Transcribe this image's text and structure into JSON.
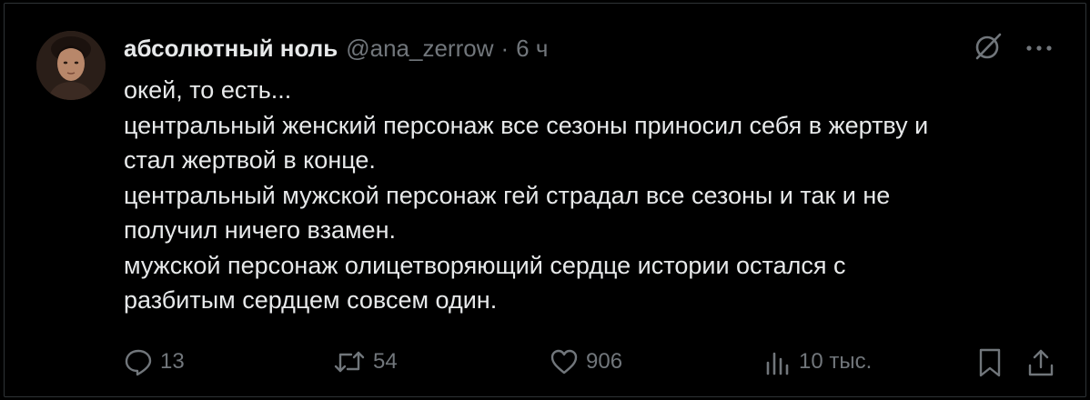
{
  "tweet": {
    "display_name": "абсолютный ноль",
    "handle": "@ana_zerrow",
    "separator": "·",
    "timestamp": "6 ч",
    "text": "окей, то есть...\nцентральный женский персонаж все сезоны приносил себя в жертву и\nстал жертвой в конце.\nцентральный мужской персонаж гей страдал все сезоны и так и не\nполучил ничего взамен.\nмужской персонаж олицетворяющий сердце истории остался с\nразбитым сердцем совсем один."
  },
  "header_icons": [
    "grok-icon",
    "more-icon"
  ],
  "actions": {
    "reply": {
      "icon": "reply-icon",
      "count": "13"
    },
    "repost": {
      "icon": "repost-icon",
      "count": "54"
    },
    "like": {
      "icon": "heart-icon",
      "count": "906"
    },
    "views": {
      "icon": "analytics-icon",
      "count": "10 тыс."
    },
    "bookmark": {
      "icon": "bookmark-icon"
    },
    "share": {
      "icon": "share-icon"
    }
  },
  "colors": {
    "background": "#000000",
    "text": "#e7e9ea",
    "secondary": "#71767b",
    "border": "#2f3336"
  }
}
